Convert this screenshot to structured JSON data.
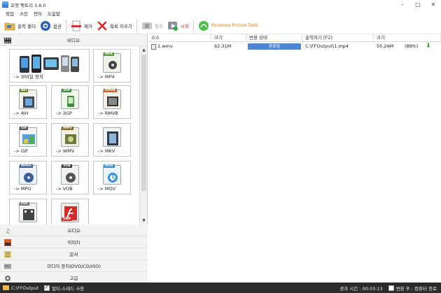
{
  "window": {
    "title": "포맷 팩토리 3.8.0",
    "buttons": [
      "–",
      "□",
      "✕"
    ]
  },
  "menu": [
    "작업",
    "스킨",
    "언어",
    "도움말"
  ],
  "toolbar": {
    "output_folder": "출력 폴더",
    "options": "옵션",
    "remove": "제거",
    "clear_list": "목록 지우기",
    "stop": "정지",
    "start": "시작",
    "picture_tools": "Picosmos Picture Tools"
  },
  "categories": {
    "video": "비디오",
    "audio": "오디오",
    "image": "이미지",
    "document": "문서",
    "media_device": "미디어 장치(DVD/CD/ISO)",
    "advanced": "고급"
  },
  "tiles": {
    "mobile": "-> 모바일 장치",
    "mp4": "-> MP4",
    "avi": "-> AVI",
    "tgp": "-> 3GP",
    "rmvb": "-> RMVB",
    "gif": "-> GIF",
    "wmv": "-> WMV",
    "mkv": "-> MKV",
    "mpg": "-> MPG",
    "vob": "-> VOB",
    "mov": "-> MOV",
    "badge_mp4": "MP4",
    "badge_avi": "AVI",
    "badge_3gp": "3GP",
    "badge_rmvb": "RMVB",
    "badge_gif": "GIF",
    "badge_wmv": "WMV",
    "badge_mpeg": "MPEG",
    "badge_vob": "VOB",
    "badge_mov": "MOV",
    "badge_pdf": "PDF",
    "badge_swf": "SWF"
  },
  "table": {
    "headers": [
      "소스",
      "크기",
      "변환 상태",
      "출력하기 [F2]",
      "크기"
    ],
    "rows": [
      {
        "source": "1.wmv",
        "size": "62.31M",
        "status": "완료됨",
        "output": "C:\\FFOutput\\1.mp4",
        "out_size": "55.24M",
        "ratio": "(88%)"
      }
    ]
  },
  "statusbar": {
    "path": "C:\\FFOutput",
    "multithread": "멀티-스레드 사용",
    "elapsed": "경과 시간 : 00:03:13",
    "after": "변환 후 : 컴퓨터 종료"
  },
  "colors": {
    "status_pill": "#4a86d8",
    "statusbar_bg": "#2b2b2b",
    "start_text": "#d02020"
  }
}
